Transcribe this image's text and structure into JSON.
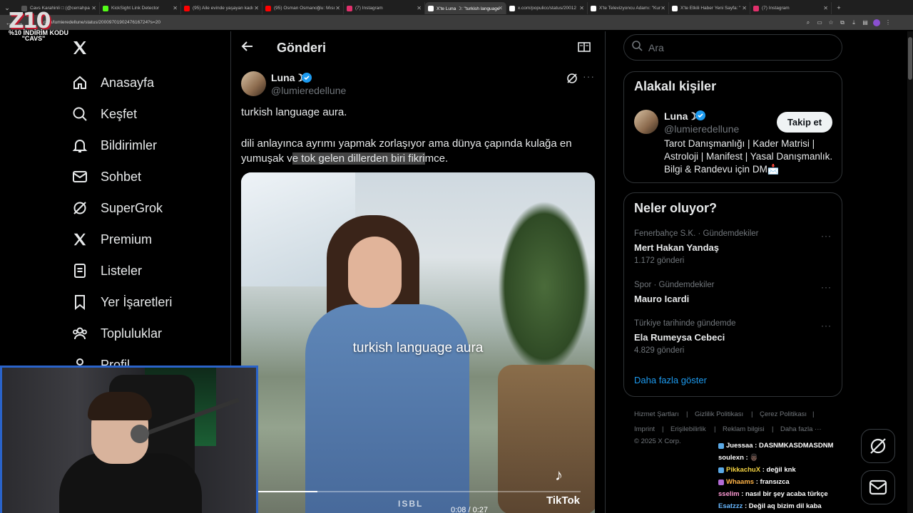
{
  "browser": {
    "tabs": [
      {
        "title": "Cavs Karahinli □ (@cerrahpa",
        "color": "#555"
      },
      {
        "title": "KickSight Link Detector",
        "color": "#53fc18"
      },
      {
        "title": "(95) Aile evinde yaşayan kadı",
        "color": "#ff0000"
      },
      {
        "title": "(95) Osman Osmanoğlu: Mısı",
        "color": "#ff0000"
      },
      {
        "title": "(7) Instagram",
        "color": "#e1306c"
      },
      {
        "title": "X'te Luna ☽: \"turkish language",
        "color": "#fff"
      },
      {
        "title": "x.com/populicc/status/20012",
        "color": "#fff"
      },
      {
        "title": "X'te Televizyoncu Adamı: \"Kur",
        "color": "#fff"
      },
      {
        "title": "X'te Etkili Haber Yeni Sayfa: \"",
        "color": "#fff"
      },
      {
        "title": "(7) Instagram",
        "color": "#e1306c"
      }
    ],
    "active_tab_index": 5,
    "url": "x.com/lumieredellune/status/2000970190247616724?s=20"
  },
  "logo_overlay": {
    "brand": "Z10",
    "code_line": "%10 İNDİRİM KODU",
    "code": "\"CAVS\""
  },
  "nav": {
    "items": [
      {
        "label": "Anasayfa",
        "icon": "home-icon"
      },
      {
        "label": "Keşfet",
        "icon": "search-icon"
      },
      {
        "label": "Bildirimler",
        "icon": "bell-icon"
      },
      {
        "label": "Sohbet",
        "icon": "mail-icon"
      },
      {
        "label": "SuperGrok",
        "icon": "grok-icon"
      },
      {
        "label": "Premium",
        "icon": "x-icon"
      },
      {
        "label": "Listeler",
        "icon": "list-icon"
      },
      {
        "label": "Yer İşaretleri",
        "icon": "bookmark-icon"
      },
      {
        "label": "Topluluklar",
        "icon": "communities-icon"
      },
      {
        "label": "Profil",
        "icon": "profile-icon"
      }
    ]
  },
  "post": {
    "header_title": "Gönderi",
    "author_name": "Luna☽",
    "author_handle": "@lumieredellune",
    "line1": "turkish language aura.",
    "text_before": "dili anlayınca ayrımı yapmak zorlaşıyor ama dünya çapında kulağa en yumuşak v",
    "text_highlight": "e tok gelen dillerden biri fikri",
    "text_after": "mce.",
    "video": {
      "caption": "turkish language aura",
      "time": "0:08 / 0:27",
      "progress": 0.19,
      "watermark": "TikTok",
      "brand": "ISBL"
    }
  },
  "search": {
    "placeholder": "Ara"
  },
  "related": {
    "title": "Alakalı kişiler",
    "name": "Luna☽",
    "handle": "@lumieredellune",
    "follow_label": "Takip et",
    "bio": "Tarot Danışmanlığı | Kader Matrisi | Astroloji | Manifest | Yasal Danışmanlık. Bilgi & Randevu için DM📩"
  },
  "trends": {
    "title": "Neler oluyor?",
    "items": [
      {
        "context": "Fenerbahçe S.K. · Gündemdekiler",
        "name": "Mert Hakan Yandaş",
        "count": "1.172 gönderi"
      },
      {
        "context": "Spor · Gündemdekiler",
        "name": "Mauro Icardi",
        "count": ""
      },
      {
        "context": "Türkiye tarihinde gündemde",
        "name": "Ela Rumeysa Cebeci",
        "count": "4.829 gönderi"
      }
    ],
    "show_more": "Daha fazla göster"
  },
  "footer": {
    "links": [
      "Hizmet Şartları",
      "Gizlilik Politikası",
      "Çerez Politikası",
      "Imprint",
      "Erişilebilirlik",
      "Reklam bilgisi",
      "Daha fazla ···"
    ],
    "copyright": "© 2025 X Corp."
  },
  "chat": [
    {
      "user": "Juessaa",
      "msg": "DASNMKASDMASDNM",
      "color": "#ffffff",
      "badge": "#5aa9e6"
    },
    {
      "user": "soulexn",
      "msg": "👨🏿",
      "color": "#ffffff",
      "badge": ""
    },
    {
      "user": "PikkachuX",
      "msg": "değil knk",
      "color": "#f5d442",
      "badge": "#5aa9e6"
    },
    {
      "user": "Whaams",
      "msg": "fransızca",
      "color": "#ffb347",
      "badge": "#b36bd6"
    },
    {
      "user": "sselim",
      "msg": "nasıl bir şey acaba türkçe",
      "color": "#ff9ad5",
      "badge": ""
    },
    {
      "user": "Esatzzz",
      "msg": "Değil aq bizim dil kaba",
      "color": "#67b7ff",
      "badge": ""
    }
  ],
  "colors": {
    "accent": "#1d9bf0",
    "verified": "#1d9bf0",
    "webcam_border": "#2a63c9"
  }
}
